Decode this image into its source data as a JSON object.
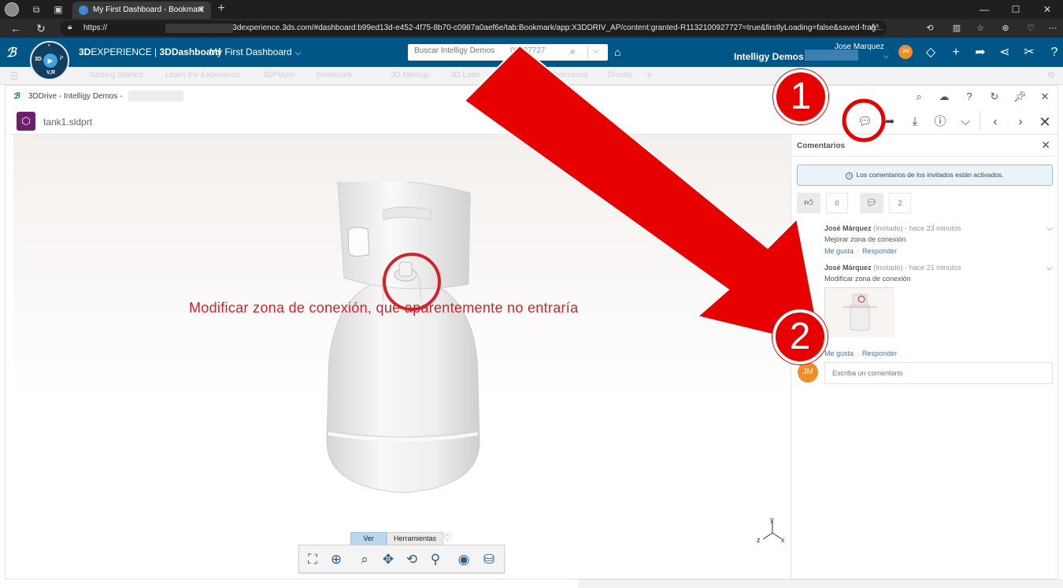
{
  "browser": {
    "tab_title": "My First Dashboard - Bookmark",
    "url_prefix": "https://",
    "url_rest": "usw1-ifwe.3dexperience.3ds.com/#dashboard:b99ed13d-e452-4f75-8b70-c0987a0aef6e/tab:Bookmark/app:X3DDRIV_AP/content:granted-R1132100927727=true&firstlyLoading=false&saved-frag..."
  },
  "appbar": {
    "compass_q_left": "3D",
    "compass_q_right": "i²",
    "compass_q_top": "³",
    "compass_q_bottom": "V,R",
    "brand_light": "3D",
    "brand_bold": "EXPERIENCE",
    "brand_sep": " | ",
    "brand_app": "3DDashboard",
    "dashboard_title": "My First Dashboard",
    "search_placeholder": "Buscar Intelligy Demos",
    "search_extra": "00927727",
    "tenant": "Intelligy Demos -",
    "user_name": "Jose Marquez",
    "user_initials": "JM"
  },
  "dashboard_tabs": [
    "Getting Started",
    "Learn the Experience",
    "3DPlayer",
    "Bookmark",
    "3D Markup",
    "3D Lean",
    "Processes",
    "Diseño"
  ],
  "drive": {
    "title": "3DDrive - Intelligy Demos -",
    "file_name": "tank1.sldprt"
  },
  "viewer": {
    "annotation_text": "Modificar zona de conexión, que aparentemente no entraría",
    "axis_x": "x",
    "axis_y": "y",
    "axis_z": "z",
    "toolbar_tabs": [
      "Ver",
      "Herramientas"
    ]
  },
  "comments": {
    "title": "Comentarios",
    "info": "Los comentarios de los invitados están activados.",
    "likes_count": "0",
    "comments_count": "2",
    "items": [
      {
        "author": "José Márquez",
        "role": "(Invitado)",
        "time": " - hace 23 minutos",
        "text": "Mejorar zona de conexión",
        "like": "Me gusta",
        "reply": "Responder"
      },
      {
        "author": "José Márquez",
        "role": "(Invitado)",
        "time": " - hace 21 minutos",
        "text": "Modificar zona de conexión",
        "like": "Me gusta",
        "reply": "Responder"
      }
    ],
    "new_placeholder": "Escriba un comentario",
    "new_avatar": "JM"
  },
  "annotations": {
    "badge_1": "1",
    "badge_2": "2",
    "color": "#e60000"
  },
  "colors": {
    "brand_bar": "#005686",
    "accent_link": "#2f7bbf",
    "annotation_red": "#d1242a"
  }
}
